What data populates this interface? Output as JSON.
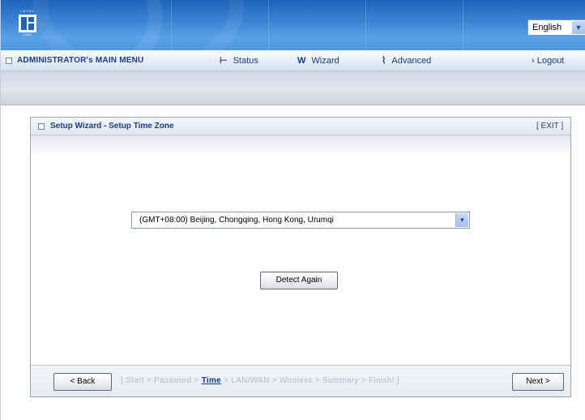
{
  "header": {
    "logo": {
      "icon": "level-one-logo",
      "caption": "LEVEL",
      "subcaption": "ONE"
    },
    "language": {
      "selected": "English",
      "icon": "chevron-down-icon"
    }
  },
  "menu": {
    "admin_label": "ADMINISTRATOR's MAIN MENU",
    "status_label": "Status",
    "wizard_label": "Wizard",
    "advanced_label": "Advanced",
    "logout_label": "› Logout"
  },
  "panel": {
    "title": "Setup Wizard - Setup Time Zone",
    "exit_label": "[ EXIT ]",
    "timezone": {
      "selected": "(GMT+08:00) Beijing, Chongqing, Hong Kong, Urumqi"
    },
    "detect_label": "Detect Again",
    "back_label": "< Back",
    "next_label": "Next >",
    "steps": {
      "prefix": "[ Start > Password > ",
      "current": "Time",
      "suffix": " > LAN/WAN > Wireless > Summary > Finish! ]"
    }
  },
  "colors": {
    "header_blue": "#3d86d4",
    "menu_text": "#1a3a8c",
    "inactive_step": "#b4bac6"
  }
}
